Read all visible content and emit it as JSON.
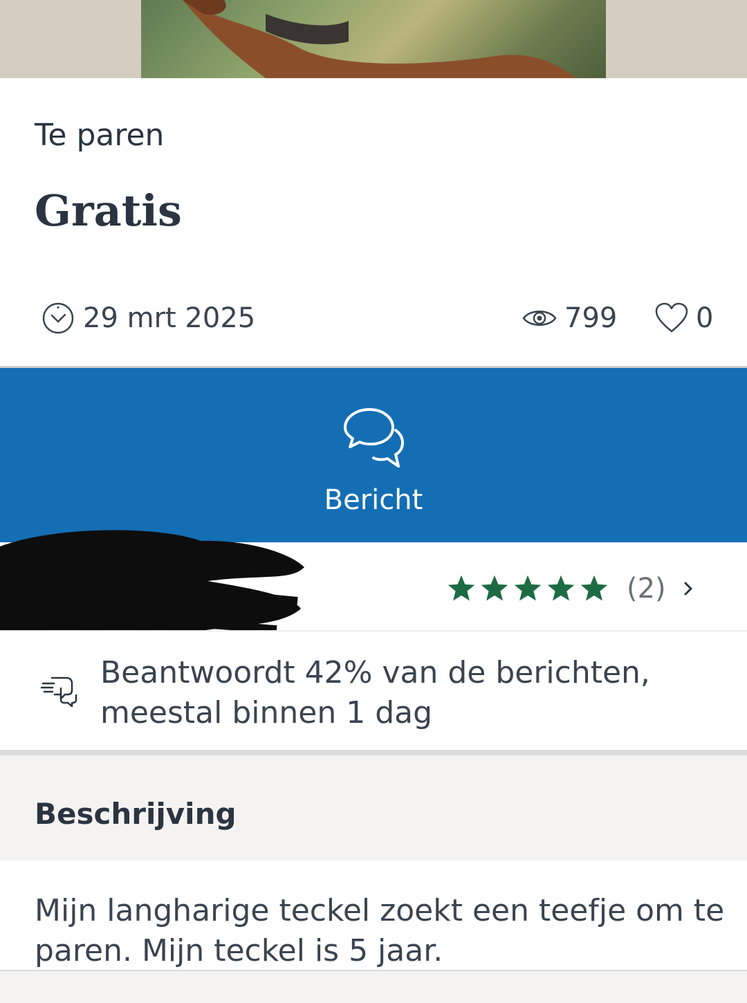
{
  "listing": {
    "category": "Te paren",
    "price": "Gratis",
    "date": "29 mrt 2025",
    "views": "799",
    "favorites": "0"
  },
  "actions": {
    "message_label": "Bericht"
  },
  "seller": {
    "rating_stars": 5,
    "review_count": "(2)",
    "response_text_line1": "Beantwoordt 42% van de berichten,",
    "response_text_line2": "meestal binnen 1 dag"
  },
  "description": {
    "title": "Beschrijving",
    "text": "Mijn langharige teckel zoekt een teefje om te paren. Mijn teckel is 5 jaar."
  },
  "colors": {
    "primary_blue": "#146eb4",
    "star_green": "#1d6b45",
    "text_dark": "#2b3440"
  },
  "icons": {
    "date": "clock-icon",
    "views": "eye-icon",
    "favorites": "heart-icon",
    "message": "chat-bubbles-icon",
    "response": "fast-reply-icon"
  }
}
